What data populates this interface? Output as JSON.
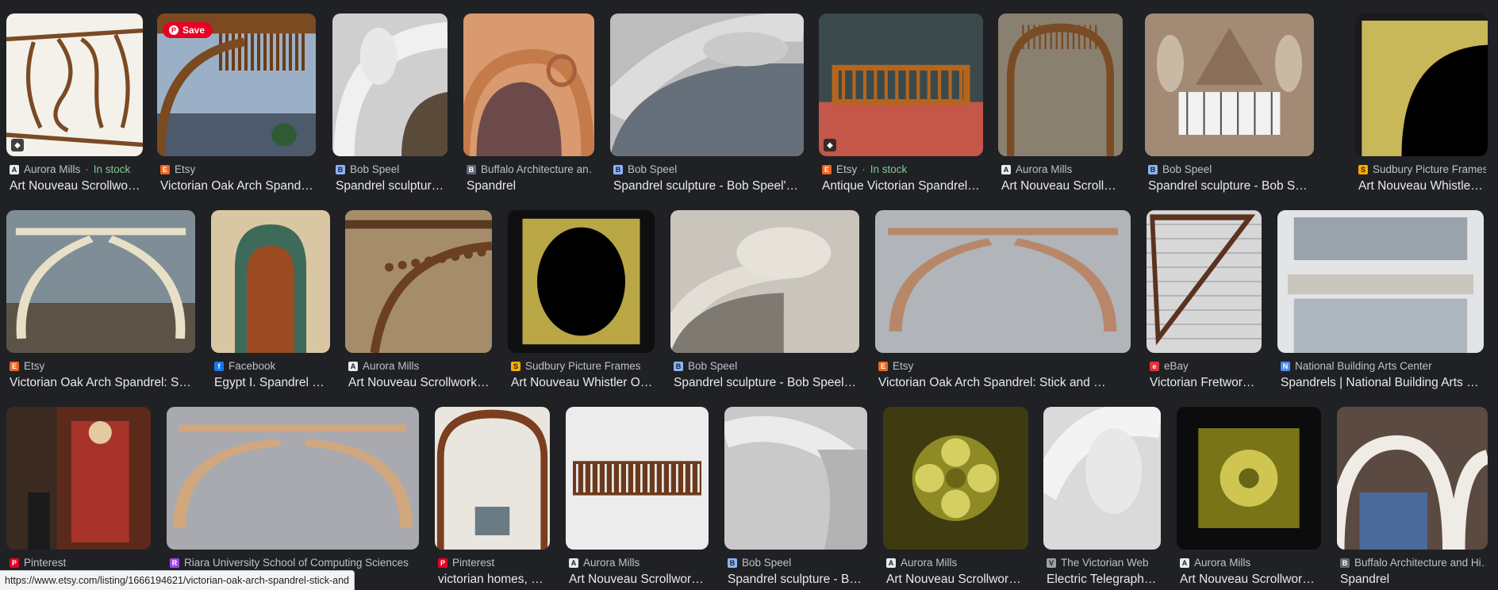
{
  "colors": {
    "background": "#202124",
    "title_text": "#e8eaed",
    "source_text": "#bdc1c6",
    "in_stock": "#81c995",
    "pinterest_red": "#e60023"
  },
  "save_button": {
    "label": "Save",
    "icon": "pinterest-icon"
  },
  "status_bar": {
    "url": "https://www.etsy.com/listing/1666194621/victorian-oak-arch-spandrel-stick-and"
  },
  "rows": [
    {
      "items": [
        {
          "source": "Aurora Mills",
          "stock": "In stock",
          "title": "Art Nouveau Scrollwor…",
          "icon": "aurora-mills-icon",
          "shopping_tag": true
        },
        {
          "source": "Etsy",
          "title": "Victorian Oak Arch Spandrel: …",
          "icon": "etsy-icon",
          "save": true
        },
        {
          "source": "Bob Speel",
          "title": "Spandrel sculpture -…",
          "icon": "bob-speel-icon"
        },
        {
          "source": "Buffalo Architecture an…",
          "title": "Spandrel",
          "icon": "buffalo-architecture-icon"
        },
        {
          "source": "Bob Speel",
          "title": "Spandrel sculpture - Bob Speel's W…",
          "icon": "bob-speel-icon"
        },
        {
          "source": "Etsy",
          "stock": "In stock",
          "title": "Antique Victorian Spandrel Fr…",
          "icon": "etsy-icon",
          "shopping_tag": true
        },
        {
          "source": "Aurora Mills",
          "title": "Art Nouveau Scrollwor…",
          "icon": "aurora-mills-icon"
        },
        {
          "source": "Bob Speel",
          "title": "Spandrel sculpture - Bob Speel's W…",
          "icon": "bob-speel-icon"
        },
        {
          "source": "Sudbury Picture Frames",
          "title": "Art Nouveau Whistler …",
          "icon": "sudbury-frames-icon"
        }
      ]
    },
    {
      "items": [
        {
          "source": "Etsy",
          "title": "Victorian Oak Arch Spandrel: Stick…",
          "icon": "etsy-icon"
        },
        {
          "source": "Facebook",
          "title": "Egypt I. Spandrel ab…",
          "icon": "facebook-icon"
        },
        {
          "source": "Aurora Mills",
          "title": "Art Nouveau Scrollwork S…",
          "icon": "aurora-mills-icon"
        },
        {
          "source": "Sudbury Picture Frames",
          "title": "Art Nouveau Whistler Out…",
          "icon": "sudbury-frames-icon"
        },
        {
          "source": "Bob Speel",
          "title": "Spandrel sculpture - Bob Speel's …",
          "icon": "bob-speel-icon"
        },
        {
          "source": "Etsy",
          "title": "Victorian Oak Arch Spandrel: Stick and …",
          "icon": "etsy-icon"
        },
        {
          "source": "eBay",
          "title": "Victorian Fretwork …",
          "icon": "ebay-icon"
        },
        {
          "source": "National Building Arts Center",
          "title": "Spandrels | National Building Arts Cen…",
          "icon": "national-building-arts-icon"
        }
      ]
    },
    {
      "items": [
        {
          "source": "Pinterest",
          "title": "",
          "icon": "pinterest-icon"
        },
        {
          "source": "Riara University School of Computing Sciences",
          "title": "",
          "icon": "riara-university-icon"
        },
        {
          "source": "Pinterest",
          "title": "victorian homes, vic…",
          "icon": "pinterest-icon"
        },
        {
          "source": "Aurora Mills",
          "title": "Art Nouveau Scrollwork S…",
          "icon": "aurora-mills-icon"
        },
        {
          "source": "Bob Speel",
          "title": "Spandrel sculpture - Bob …",
          "icon": "bob-speel-icon"
        },
        {
          "source": "Aurora Mills",
          "title": "Art Nouveau Scrollwork S…",
          "icon": "aurora-mills-icon"
        },
        {
          "source": "The Victorian Web",
          "title": "Electric Telegraph (…",
          "icon": "victorian-web-icon"
        },
        {
          "source": "Aurora Mills",
          "title": "Art Nouveau Scrollwork S…",
          "icon": "aurora-mills-icon"
        },
        {
          "source": "Buffalo Architecture and Hi…",
          "title": "Spandrel",
          "icon": "buffalo-architecture-icon"
        }
      ]
    }
  ]
}
